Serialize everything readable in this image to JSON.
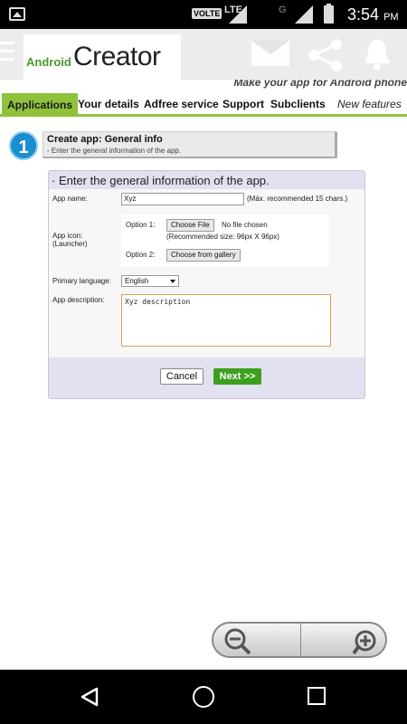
{
  "status_bar": {
    "volte": "VOLTE",
    "network1": "LTE",
    "network2": "G",
    "time": "3:54",
    "ampm": "PM"
  },
  "header": {
    "logo_small": "Android",
    "logo_large": "Creator",
    "tagline": "Make your app for Android phone"
  },
  "nav": {
    "items": [
      "Applications",
      "Your details",
      "Adfree service",
      "Support",
      "Subclients",
      "New features"
    ]
  },
  "step": {
    "number": "1",
    "title": "Create app: General info",
    "subtitle": "- Enter the general information of the app."
  },
  "form": {
    "section_title": "· Enter the general information of the app.",
    "app_name_label": "App name:",
    "app_name_value": "Xyz",
    "app_name_hint": "(Máx. recommended 15 chars.)",
    "app_icon_label_1": "App icon:",
    "app_icon_label_2": "(Launcher)",
    "option1_label": "Option 1:",
    "choose_file": "Choose File",
    "no_file": "No file chosen",
    "recommended_size": "(Recommended size: 96px X 96px)",
    "option2_label": "Option 2:",
    "choose_gallery": "Choose from gallery",
    "language_label": "Primary language:",
    "language_value": "English",
    "description_label": "App description:",
    "description_value": "Xyz description",
    "cancel": "Cancel",
    "next": "Next >>"
  },
  "colors": {
    "accent_green": "#8fc23b",
    "next_green": "#3d9f1e",
    "step_blue": "#1a8fd0",
    "panel": "#e1e1f0"
  },
  "icons": [
    "gallery-icon",
    "signal-icon",
    "battery-icon",
    "menu-icon",
    "mail-icon",
    "share-icon",
    "bell-icon",
    "zoom-out-icon",
    "zoom-in-icon",
    "back-icon",
    "home-icon",
    "recents-icon"
  ]
}
